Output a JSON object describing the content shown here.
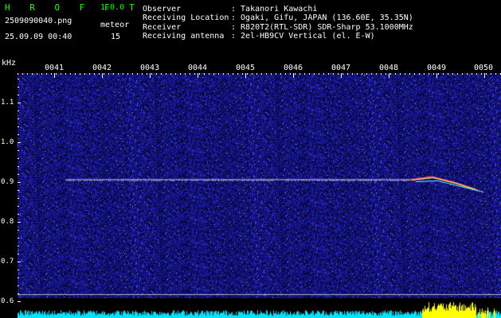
{
  "app": {
    "name": "H R O F F T",
    "version": "1.0.0"
  },
  "file": {
    "name": "2509090040.png",
    "datetime": "25.09.09 00:40"
  },
  "meteor": {
    "label": "meteor",
    "count": "15"
  },
  "info": [
    {
      "key": "Observer",
      "value": ": Takanori Kawachi"
    },
    {
      "key": "Receiving Location",
      "value": ": Ogaki, Gifu, JAPAN (136.60E, 35.35N)"
    },
    {
      "key": "Receiver",
      "value": ": R820T2(RTL-SDR) SDR-Sharp 53.1000MHz"
    },
    {
      "key": "Receiving antenna",
      "value": ": 2el-HB9CV Vertical (el. E-W)"
    }
  ],
  "spectrogram": {
    "y_unit": "kHz",
    "y_ticks": [
      "1.1",
      "1.0",
      "0.9",
      "0.8",
      "0.7",
      "0.6"
    ],
    "y_tick_values": [
      1.1,
      1.0,
      0.9,
      0.8,
      0.7,
      0.6
    ],
    "time_labels": [
      "0041",
      "0042",
      "0043",
      "0044",
      "0045",
      "0046",
      "0047",
      "0048",
      "0049",
      "0050"
    ],
    "carrier_khz": 0.905,
    "colors": {
      "background": "#0a0a5a",
      "noise": "#1c1cc8",
      "carrier": "#ffffff",
      "level_trace": "#00e5ff",
      "level_peak": "#ffff00",
      "title": "#19ff00"
    }
  }
}
